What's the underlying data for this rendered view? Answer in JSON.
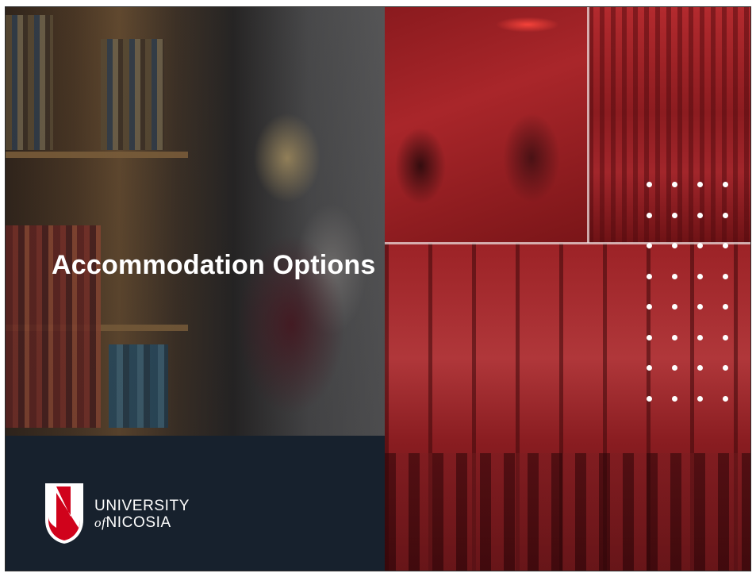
{
  "slide": {
    "title": "Accommodation Options",
    "dots": 32
  },
  "logo": {
    "line1": "UNIVERSITY",
    "prefix": "of",
    "name": "NICOSIA"
  },
  "colors": {
    "navy": "#17212d",
    "brand_red": "#d0021b",
    "overlay_red": "#a9262a"
  }
}
